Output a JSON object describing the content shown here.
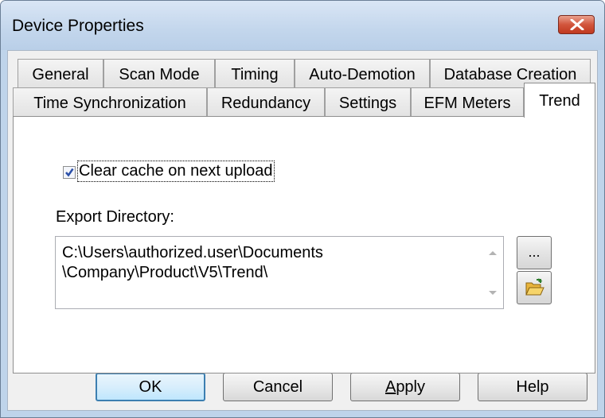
{
  "window": {
    "title": "Device Properties",
    "close_icon": "close-x-icon"
  },
  "tabs_row1": [
    "General",
    "Scan Mode",
    "Timing",
    "Auto-Demotion",
    "Database Creation"
  ],
  "tabs_row2": [
    "Time Synchronization",
    "Redundancy",
    "Settings",
    "EFM Meters",
    "Trend"
  ],
  "active_tab": "Trend",
  "trend": {
    "clear_cache_label": "Clear cache on next upload",
    "clear_cache_checked": true,
    "export_dir_label": "Export Directory:",
    "export_dir_value": "C:\\Users\\authorized.user\\Documents\n\\Company\\Product\\V5\\Trend\\",
    "browse_label": "...",
    "folder_icon": "open-folder-icon"
  },
  "buttons": {
    "ok": "OK",
    "cancel": "Cancel",
    "apply": "Apply",
    "help": "Help"
  },
  "colors": {
    "accent": "#3c7fb1",
    "close": "#c0391f",
    "titlebar": "#c3d6ec"
  }
}
